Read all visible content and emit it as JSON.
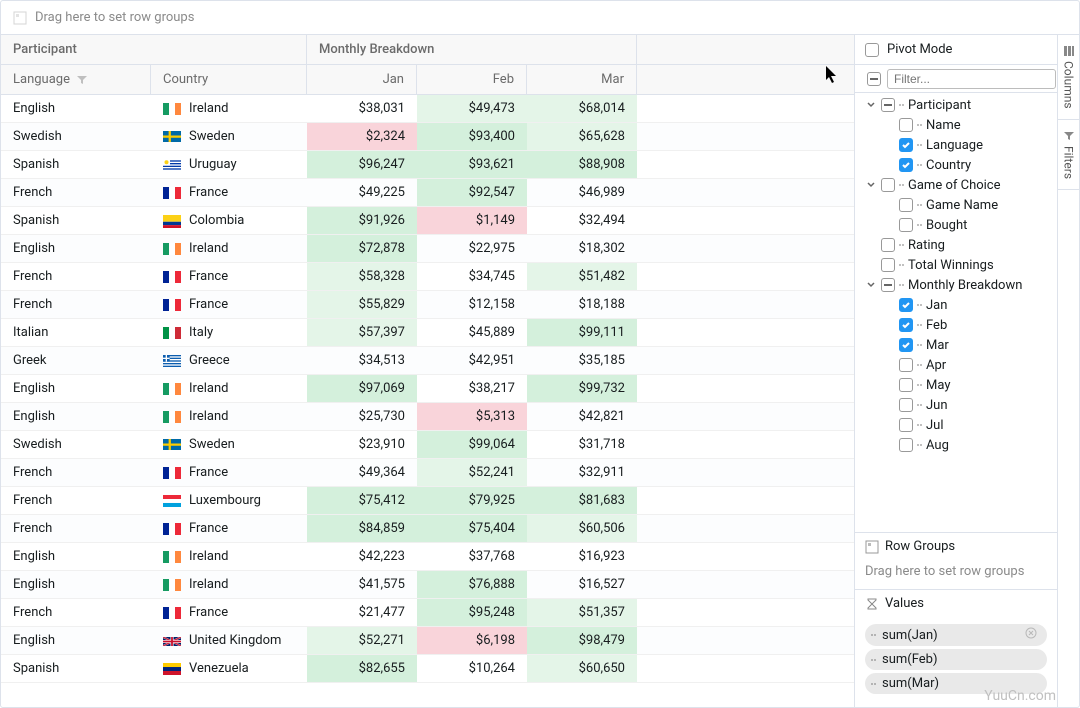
{
  "topDropZone": "Drag here to set row groups",
  "headers": {
    "participantGroup": "Participant",
    "monthlyGroup": "Monthly Breakdown",
    "language": "Language",
    "country": "Country",
    "jan": "Jan",
    "feb": "Feb",
    "mar": "Mar"
  },
  "rows": [
    {
      "lang": "English",
      "country": "Ireland",
      "flag": "ie",
      "jan": "$38,031",
      "feb": "$49,473",
      "mar": "$68,014",
      "jc": "",
      "fc": "shade-g1",
      "mc": "shade-g1"
    },
    {
      "lang": "Swedish",
      "country": "Sweden",
      "flag": "se",
      "jan": "$2,324",
      "feb": "$93,400",
      "mar": "$65,628",
      "jc": "shade-r1",
      "fc": "shade-g2",
      "mc": "shade-g1"
    },
    {
      "lang": "Spanish",
      "country": "Uruguay",
      "flag": "uy",
      "jan": "$96,247",
      "feb": "$93,621",
      "mar": "$88,908",
      "jc": "shade-g2",
      "fc": "shade-g2",
      "mc": "shade-g2"
    },
    {
      "lang": "French",
      "country": "France",
      "flag": "fr",
      "jan": "$49,225",
      "feb": "$92,547",
      "mar": "$46,989",
      "jc": "",
      "fc": "shade-g2",
      "mc": ""
    },
    {
      "lang": "Spanish",
      "country": "Colombia",
      "flag": "co",
      "jan": "$91,926",
      "feb": "$1,149",
      "mar": "$32,494",
      "jc": "shade-g2",
      "fc": "shade-r1",
      "mc": ""
    },
    {
      "lang": "English",
      "country": "Ireland",
      "flag": "ie",
      "jan": "$72,878",
      "feb": "$22,975",
      "mar": "$18,302",
      "jc": "shade-g2",
      "fc": "",
      "mc": ""
    },
    {
      "lang": "French",
      "country": "France",
      "flag": "fr",
      "jan": "$58,328",
      "feb": "$34,745",
      "mar": "$51,482",
      "jc": "shade-g1",
      "fc": "",
      "mc": "shade-g1"
    },
    {
      "lang": "French",
      "country": "France",
      "flag": "fr",
      "jan": "$55,829",
      "feb": "$12,158",
      "mar": "$18,188",
      "jc": "shade-g1",
      "fc": "",
      "mc": ""
    },
    {
      "lang": "Italian",
      "country": "Italy",
      "flag": "it",
      "jan": "$57,397",
      "feb": "$45,889",
      "mar": "$99,111",
      "jc": "shade-g1",
      "fc": "",
      "mc": "shade-g2"
    },
    {
      "lang": "Greek",
      "country": "Greece",
      "flag": "gr",
      "jan": "$34,513",
      "feb": "$42,951",
      "mar": "$35,185",
      "jc": "",
      "fc": "",
      "mc": ""
    },
    {
      "lang": "English",
      "country": "Ireland",
      "flag": "ie",
      "jan": "$97,069",
      "feb": "$38,217",
      "mar": "$99,732",
      "jc": "shade-g2",
      "fc": "",
      "mc": "shade-g2"
    },
    {
      "lang": "English",
      "country": "Ireland",
      "flag": "ie",
      "jan": "$25,730",
      "feb": "$5,313",
      "mar": "$42,821",
      "jc": "",
      "fc": "shade-r1",
      "mc": ""
    },
    {
      "lang": "Swedish",
      "country": "Sweden",
      "flag": "se",
      "jan": "$23,910",
      "feb": "$99,064",
      "mar": "$31,718",
      "jc": "",
      "fc": "shade-g2",
      "mc": ""
    },
    {
      "lang": "French",
      "country": "France",
      "flag": "fr",
      "jan": "$49,364",
      "feb": "$52,241",
      "mar": "$32,911",
      "jc": "",
      "fc": "shade-g1",
      "mc": ""
    },
    {
      "lang": "French",
      "country": "Luxembourg",
      "flag": "lu",
      "jan": "$75,412",
      "feb": "$79,925",
      "mar": "$81,683",
      "jc": "shade-g2",
      "fc": "shade-g2",
      "mc": "shade-g2"
    },
    {
      "lang": "French",
      "country": "France",
      "flag": "fr",
      "jan": "$84,859",
      "feb": "$75,404",
      "mar": "$60,506",
      "jc": "shade-g2",
      "fc": "shade-g2",
      "mc": "shade-g1"
    },
    {
      "lang": "English",
      "country": "Ireland",
      "flag": "ie",
      "jan": "$42,223",
      "feb": "$37,768",
      "mar": "$16,923",
      "jc": "",
      "fc": "",
      "mc": ""
    },
    {
      "lang": "English",
      "country": "Ireland",
      "flag": "ie",
      "jan": "$41,575",
      "feb": "$76,888",
      "mar": "$16,527",
      "jc": "",
      "fc": "shade-g2",
      "mc": ""
    },
    {
      "lang": "French",
      "country": "France",
      "flag": "fr",
      "jan": "$21,477",
      "feb": "$95,248",
      "mar": "$51,357",
      "jc": "",
      "fc": "shade-g2",
      "mc": "shade-g1"
    },
    {
      "lang": "English",
      "country": "United Kingdom",
      "flag": "gb",
      "jan": "$52,271",
      "feb": "$6,198",
      "mar": "$98,479",
      "jc": "shade-g1",
      "fc": "shade-r1",
      "mc": "shade-g2"
    },
    {
      "lang": "Spanish",
      "country": "Venezuela",
      "flag": "ve",
      "jan": "$82,655",
      "feb": "$10,264",
      "mar": "$60,650",
      "jc": "shade-g2",
      "fc": "",
      "mc": "shade-g1"
    }
  ],
  "sidebar": {
    "pivotMode": "Pivot Mode",
    "filterPlaceholder": "Filter...",
    "tabs": {
      "columns": "Columns",
      "filters": "Filters"
    },
    "tree": [
      {
        "label": "Participant",
        "indent": 0,
        "expand": true,
        "check": "indet"
      },
      {
        "label": "Name",
        "indent": 1,
        "check": "off"
      },
      {
        "label": "Language",
        "indent": 1,
        "check": "on"
      },
      {
        "label": "Country",
        "indent": 1,
        "check": "on"
      },
      {
        "label": "Game of Choice",
        "indent": 0,
        "expand": true,
        "check": "off"
      },
      {
        "label": "Game Name",
        "indent": 1,
        "check": "off"
      },
      {
        "label": "Bought",
        "indent": 1,
        "check": "off"
      },
      {
        "label": "Rating",
        "indent": 0,
        "check": "off",
        "noexpand": true
      },
      {
        "label": "Total Winnings",
        "indent": 0,
        "check": "off",
        "noexpand": true
      },
      {
        "label": "Monthly Breakdown",
        "indent": 0,
        "expand": true,
        "check": "indet"
      },
      {
        "label": "Jan",
        "indent": 1,
        "check": "on"
      },
      {
        "label": "Feb",
        "indent": 1,
        "check": "on"
      },
      {
        "label": "Mar",
        "indent": 1,
        "check": "on"
      },
      {
        "label": "Apr",
        "indent": 1,
        "check": "off"
      },
      {
        "label": "May",
        "indent": 1,
        "check": "off"
      },
      {
        "label": "Jun",
        "indent": 1,
        "check": "off"
      },
      {
        "label": "Jul",
        "indent": 1,
        "check": "off"
      },
      {
        "label": "Aug",
        "indent": 1,
        "check": "off"
      }
    ],
    "rowGroups": {
      "title": "Row Groups",
      "placeholder": "Drag here to set row groups"
    },
    "values": {
      "title": "Values",
      "items": [
        "sum(Jan)",
        "sum(Feb)",
        "sum(Mar)"
      ]
    }
  },
  "watermark": "YuuCn.com"
}
